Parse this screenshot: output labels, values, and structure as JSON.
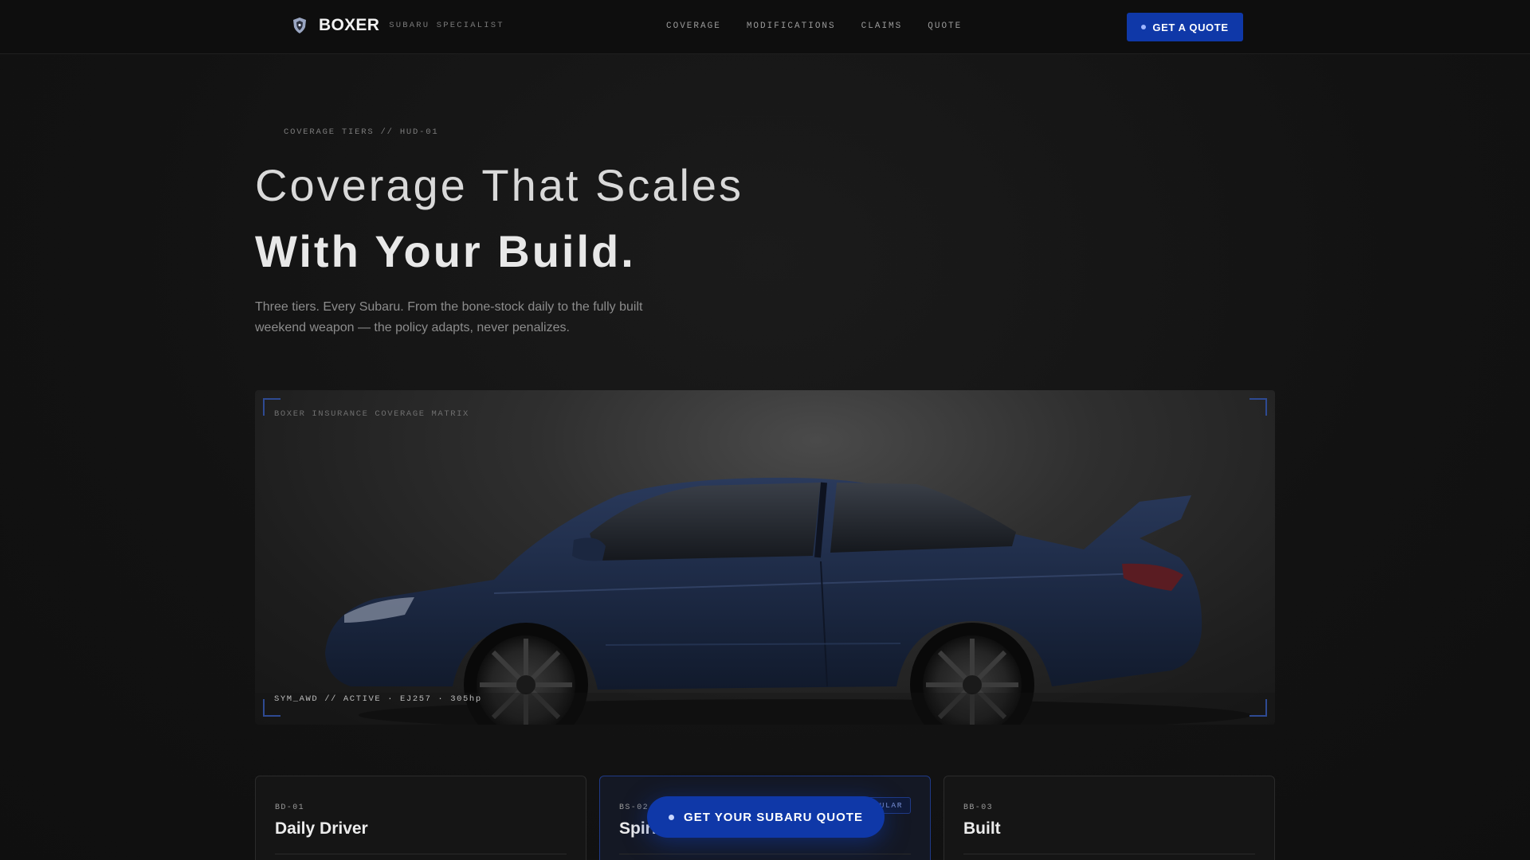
{
  "nav": {
    "brand": "BOXER",
    "tagline": "SUBARU SPECIALIST",
    "links": [
      "COVERAGE",
      "MODIFICATIONS",
      "CLAIMS",
      "QUOTE"
    ],
    "cta": "GET A QUOTE"
  },
  "hero": {
    "eyebrow": "COVERAGE TIERS // HUD-01",
    "title_line1": "Coverage That Scales",
    "title_line2": "With Your Build.",
    "lead": "Three tiers. Every Subaru. From the bone-stock daily to the fully built weekend weapon — the policy adapts, never penalizes."
  },
  "panel": {
    "label": "BOXER INSURANCE COVERAGE MATRIX",
    "status": "SYM_AWD // ACTIVE · EJ257 · 305hp"
  },
  "tiers": [
    {
      "code": "BD-01",
      "name": "Daily Driver"
    },
    {
      "code": "BS-02",
      "name": "Spirited",
      "badge": "POPULAR"
    },
    {
      "code": "BB-03",
      "name": "Built"
    }
  ],
  "floating_cta": "GET YOUR SUBARU QUOTE",
  "colors": {
    "accent": "#0f38a8",
    "background": "#121212"
  }
}
